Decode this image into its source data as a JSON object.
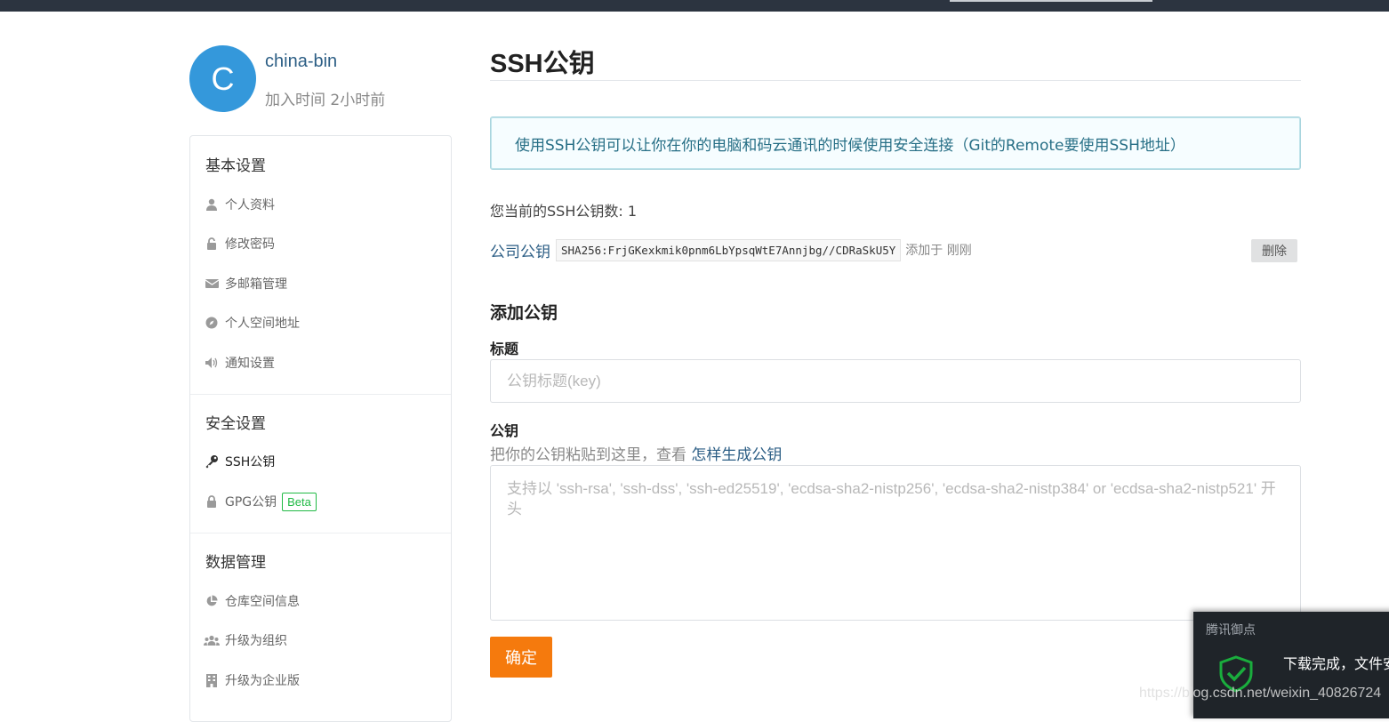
{
  "profile": {
    "avatar_letter": "C",
    "username": "china-bin",
    "joined": "加入时间 2小时前"
  },
  "sidebar": {
    "sections": [
      {
        "title": "基本设置",
        "items": [
          {
            "label": "个人资料",
            "icon": "user-icon"
          },
          {
            "label": "修改密码",
            "icon": "unlock-icon"
          },
          {
            "label": "多邮箱管理",
            "icon": "envelope-icon"
          },
          {
            "label": "个人空间地址",
            "icon": "compass-icon"
          },
          {
            "label": "通知设置",
            "icon": "volume-icon"
          }
        ]
      },
      {
        "title": "安全设置",
        "items": [
          {
            "label": "SSH公钥",
            "icon": "key-icon",
            "active": true
          },
          {
            "label": "GPG公钥",
            "icon": "lock-icon",
            "badge": "Beta"
          }
        ]
      },
      {
        "title": "数据管理",
        "items": [
          {
            "label": "仓库空间信息",
            "icon": "pie-chart-icon"
          },
          {
            "label": "升级为组织",
            "icon": "users-icon"
          },
          {
            "label": "升级为企业版",
            "icon": "building-icon"
          }
        ]
      }
    ]
  },
  "main": {
    "title": "SSH公钥",
    "info": "使用SSH公钥可以让你在你的电脑和码云通讯的时候使用安全连接（Git的Remote要使用SSH地址）",
    "count_text": "您当前的SSH公钥数: 1",
    "keys": [
      {
        "name": "公司公钥",
        "fingerprint": "SHA256:FrjGKexkmik0pnm6LbYpsqWtE7Annjbg//CDRaSkU5Y",
        "added": "添加于 刚刚",
        "delete_label": "删除"
      }
    ],
    "add_title": "添加公钥",
    "title_label": "标题",
    "title_placeholder": "公钥标题(key)",
    "key_label": "公钥",
    "hint_text": "把你的公钥粘贴到这里，查看 ",
    "hint_link": "怎样生成公钥",
    "key_placeholder": "支持以 'ssh-rsa', 'ssh-dss', 'ssh-ed25519', 'ecdsa-sha2-nistp256', 'ecdsa-sha2-nistp384' or 'ecdsa-sha2-nistp521' 开头",
    "submit_label": "确定"
  },
  "toast": {
    "title": "腾讯御点",
    "message": "下载完成，文件安"
  },
  "watermark": "https://blog.csdn.net/weixin_40826724",
  "colors": {
    "accent": "#f57a0d",
    "link": "#2c5e85",
    "avatar": "#3498db",
    "beta": "#21ba45"
  }
}
